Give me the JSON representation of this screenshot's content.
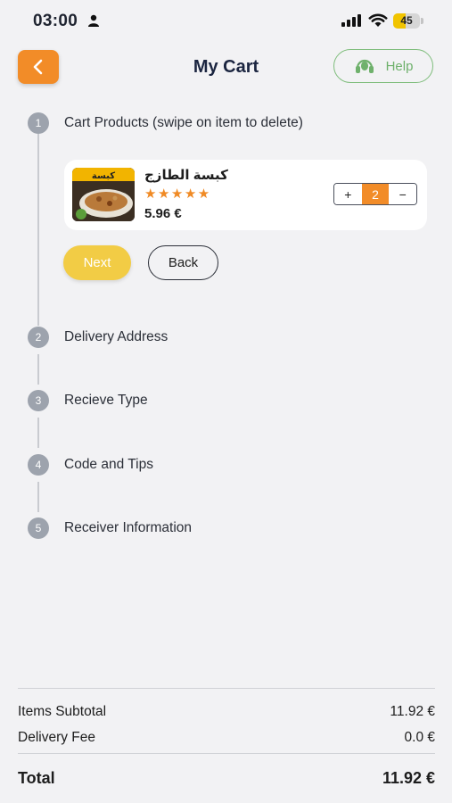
{
  "status_bar": {
    "time": "03:00",
    "battery_level": "45",
    "icons": [
      "person-icon",
      "signal-icon",
      "wifi-icon",
      "battery-icon"
    ]
  },
  "header": {
    "back_icon": "chevron-left-icon",
    "title": "My Cart",
    "help_label": "Help",
    "help_icon": "headset-icon"
  },
  "colors": {
    "accent_orange": "#f28c28",
    "next_yellow": "#f2cc45",
    "help_green": "#7fbd7c",
    "step_gray": "#9da3ad",
    "background": "#f2f2f4"
  },
  "steps": [
    {
      "number": "1",
      "label": "Cart Products (swipe on item to delete)"
    },
    {
      "number": "2",
      "label": "Delivery Address"
    },
    {
      "number": "3",
      "label": "Recieve Type"
    },
    {
      "number": "4",
      "label": "Code and Tips"
    },
    {
      "number": "5",
      "label": "Receiver Information"
    }
  ],
  "cart_item": {
    "name": "كبسة الطازج",
    "image_text": "كبسة",
    "stars": "★★★★★",
    "rating": 5,
    "price": "5.96 €",
    "quantity": "2",
    "plus": "+",
    "minus": "−"
  },
  "actions": {
    "next_label": "Next",
    "back_label": "Back"
  },
  "summary": {
    "subtotal_label": "Items Subtotal",
    "subtotal_value": "11.92 €",
    "delivery_label": "Delivery Fee",
    "delivery_value": "0.0 €",
    "total_label": "Total",
    "total_value": "11.92 €"
  }
}
